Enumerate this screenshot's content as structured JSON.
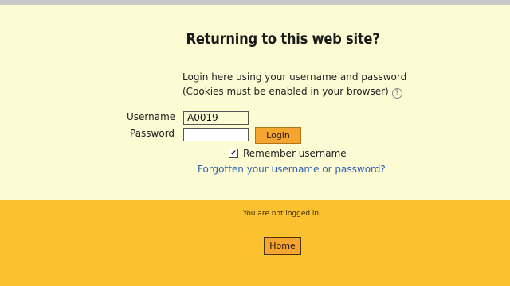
{
  "login": {
    "heading": "Returning to this web site?",
    "instructions_line1": "Login here using your username and password",
    "instructions_line2": "(Cookies must be enabled in your browser)",
    "help_icon_glyph": "?",
    "username_label": "Username",
    "username_value": "A0019",
    "password_label": "Password",
    "password_value": "",
    "login_button": "Login",
    "remember_checked": true,
    "remember_label": "Remember username",
    "forgot_link": "Forgotten your username or password?"
  },
  "footer": {
    "status_text": "You are not logged in.",
    "home_button": "Home"
  },
  "colors": {
    "panel_background": "#fdfbd3",
    "footer_background": "#fbc12f",
    "button_orange": "#f6a531",
    "link_blue": "#2e5fb0",
    "top_strip": "#c9c9c9"
  },
  "icons": {
    "help": "help-icon",
    "checkbox": "checkbox-checked-icon",
    "cursor": "text-cursor-icon"
  }
}
